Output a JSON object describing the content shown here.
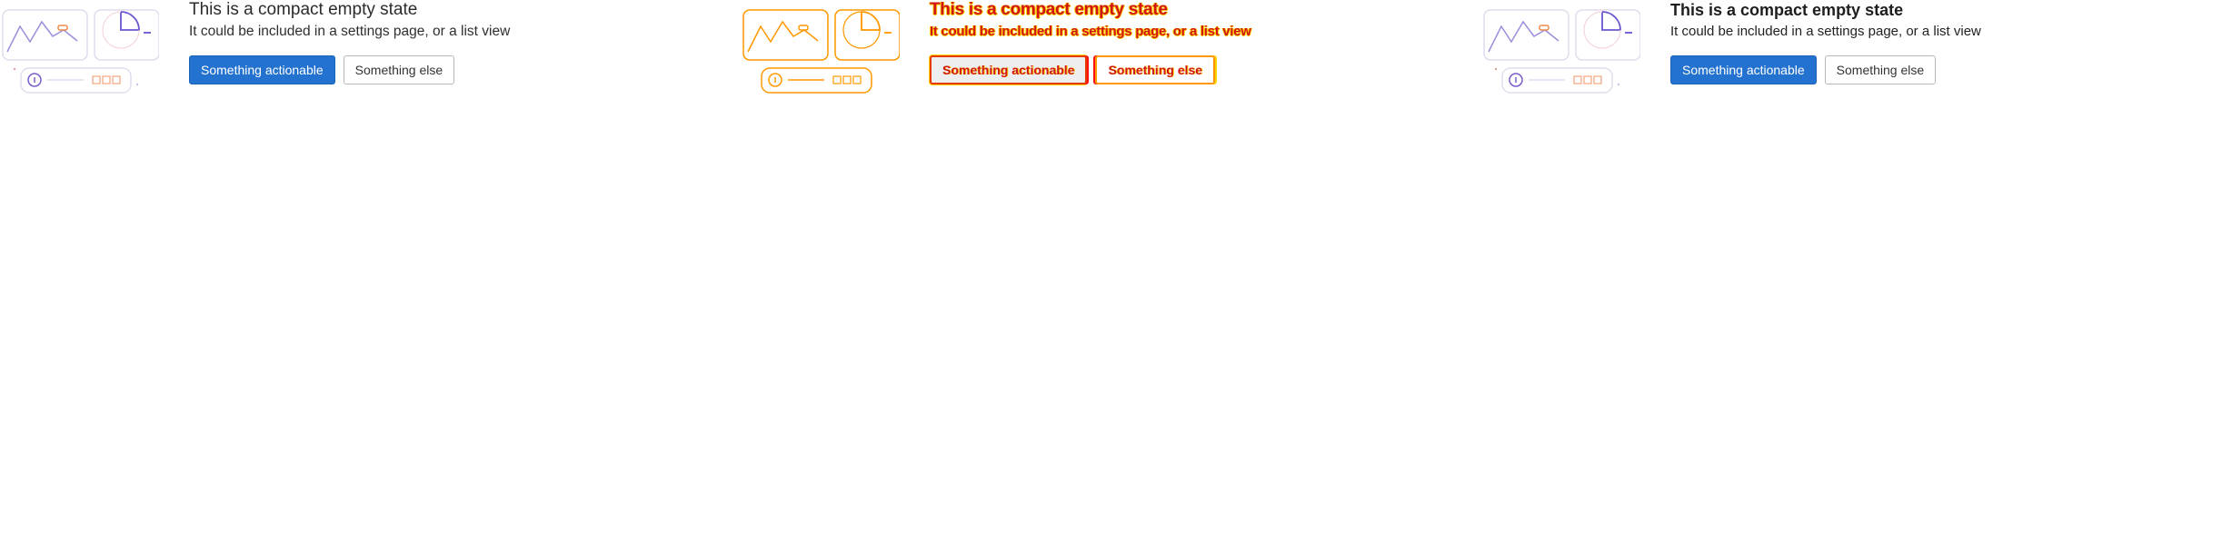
{
  "empty_state": {
    "title": "This is a compact empty state",
    "description": "It could be included in a settings page, or a list view",
    "primary_action": "Something actionable",
    "secondary_action": "Something else"
  },
  "colors": {
    "primary": "#2372d0",
    "illustration_line": "#7f6fd6",
    "illustration_accent": "#f08a4b",
    "diff_red": "#d11515",
    "diff_yellow": "#ffd400"
  },
  "icons": {
    "line_chart": "line-chart-icon",
    "pie_chart": "pie-chart-icon",
    "info": "info-icon"
  }
}
